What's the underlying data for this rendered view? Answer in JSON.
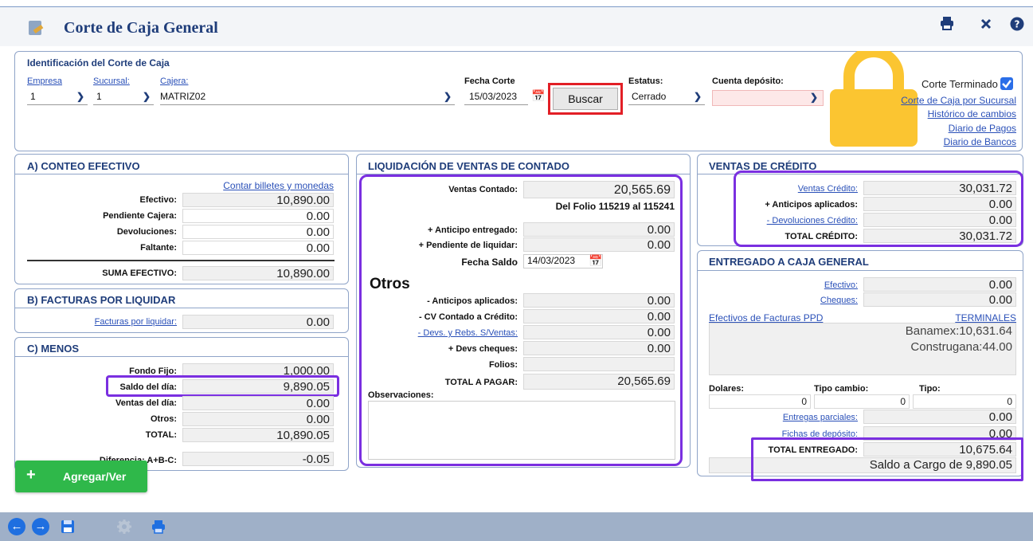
{
  "header": {
    "title": "Corte de Caja General",
    "icons": [
      "doc-edit-icon",
      "print-icon",
      "close-icon",
      "help-icon"
    ]
  },
  "ident": {
    "title": "Identificación del Corte de Caja",
    "empresa_label": "Empresa",
    "empresa_value": "1",
    "sucursal_label": "Sucursal:",
    "sucursal_value": "1",
    "cajera_label": "Cajera:",
    "cajera_value": "MATRIZ02",
    "fecha_label": "Fecha Corte",
    "fecha_value": "15/03/2023",
    "buscar_label": "Buscar",
    "estatus_label": "Estatus:",
    "estatus_value": "Cerrado",
    "cuenta_label": "Cuenta depósito:",
    "cuenta_value": "",
    "terminado_label": "Corte Terminado",
    "links": [
      "Corte de Caja por Sucursal",
      "Histórico de cambios",
      "Diario de Pagos",
      "Diario de Bancos"
    ]
  },
  "conteo": {
    "title": "A) CONTEO EFECTIVO",
    "contar_link": "Contar billetes y monedas",
    "rows": [
      {
        "label": "Efectivo:",
        "value": "10,890.00"
      },
      {
        "label": "Pendiente Cajera:",
        "value": "0.00"
      },
      {
        "label": "Devoluciones:",
        "value": "0.00"
      },
      {
        "label": "Faltante:",
        "value": "0.00"
      }
    ],
    "suma_label": "SUMA EFECTIVO:",
    "suma_value": "10,890.00"
  },
  "facturas": {
    "title": "B) FACTURAS POR LIQUIDAR",
    "link": "Facturas por liquidar:",
    "value": "0.00"
  },
  "menos": {
    "title": "C) MENOS",
    "rows": [
      {
        "label": "Fondo Fijo:",
        "value": "1,000.00"
      },
      {
        "label": "Saldo del día:",
        "value": "9,890.05"
      },
      {
        "label": "Ventas del día:",
        "value": "0.00"
      },
      {
        "label": "Otros:",
        "value": "0.00"
      },
      {
        "label": "TOTAL:",
        "value": "10,890.05"
      }
    ],
    "diferencia_label": "Diferencia: A+B-C:",
    "diferencia_value": "-0.05",
    "agregar_label": "Agregar/Ver"
  },
  "liquidacion": {
    "title": "LIQUIDACIÓN DE VENTAS DE CONTADO",
    "ventas_label": "Ventas Contado:",
    "ventas_value": "20,565.69",
    "folio_text": "Del Folio 115219 al 115241",
    "anticipo_label": "+ Anticipo entregado:",
    "anticipo_value": "0.00",
    "pendiente_label": "+ Pendiente de liquidar:",
    "pendiente_value": "0.00",
    "fecha_saldo_label": "Fecha Saldo",
    "fecha_saldo_value": "14/03/2023",
    "otros_title": "Otros",
    "otros_rows": [
      {
        "label": "- Anticipos aplicados:",
        "value": "0.00",
        "link": false
      },
      {
        "label": "- CV Contado a Crédito:",
        "value": "0.00",
        "link": false
      },
      {
        "label": "- Devs. y Rebs. S/Ventas:",
        "value": "0.00",
        "link": true
      },
      {
        "label": "+ Devs cheques:",
        "value": "0.00",
        "link": false
      },
      {
        "label": "Folios:",
        "value": "",
        "link": false
      }
    ],
    "total_label": "TOTAL A PAGAR:",
    "total_value": "20,565.69",
    "observaciones_label": "Observaciones:"
  },
  "credito": {
    "title": "VENTAS DE CRÉDITO",
    "rows": [
      {
        "label": "Ventas Crédito:",
        "value": "30,031.72",
        "link": true
      },
      {
        "label": "+ Anticipos aplicados:",
        "value": "0.00",
        "link": false
      },
      {
        "label": "- Devoluciones Crédito:",
        "value": "0.00",
        "link": true
      },
      {
        "label": "TOTAL CRÉDITO:",
        "value": "30,031.72",
        "link": false
      }
    ]
  },
  "entregado": {
    "title": "ENTREGADO A CAJA GENERAL",
    "efectivo_label": "Efectivo:",
    "efectivo_value": "0.00",
    "cheques_label": "Cheques:",
    "cheques_value": "0.00",
    "ppd_link": "Efectivos de Facturas PPD",
    "terminales_link": "TERMINALES",
    "terminal_lines": [
      "Banamex:10,631.64",
      "Construgana:44.00"
    ],
    "dolares_label": "Dolares:",
    "dolares_value": "0",
    "tipo_cambio_label": "Tipo cambio:",
    "tipo_cambio_value": "0",
    "tipo_label": "Tipo:",
    "tipo_value": "0",
    "parciales_label": "Entregas parciales:",
    "parciales_value": "0.00",
    "fichas_label": "Fichas de depósito:",
    "fichas_value": "0.00",
    "total_label": "TOTAL ENTREGADO:",
    "total_value": "10,675.64",
    "saldo_text": "Saldo a Cargo de 9,890.05"
  },
  "colors": {
    "brand": "#1f3d7a",
    "highlight_frame": "#7a2fe0",
    "highlight_red": "#e21f26",
    "lock": "#fbc531",
    "add_button": "#2fb84a"
  },
  "footer": {
    "icons": [
      "back-arrow-icon",
      "forward-arrow-icon",
      "save-icon",
      "settings-icon",
      "print-icon"
    ]
  }
}
